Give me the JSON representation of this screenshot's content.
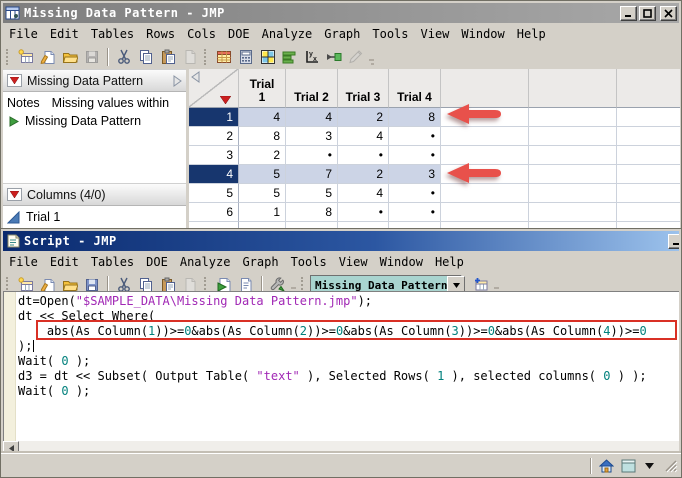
{
  "colors": {
    "accent_red": "#d93025",
    "arrow_red": "#e8514b",
    "selection_row": "#ccd4e6",
    "selection_header": "#17366e",
    "code_string": "#a128b5",
    "code_number": "#00807c",
    "combo_bg": "#a9d4cf",
    "titlebar_active": "#0a2a6e",
    "titlebar_inactive": "#8a8a8a"
  },
  "window1": {
    "title": "Missing Data Pattern - JMP",
    "title_buttons": [
      "minimize",
      "maximize",
      "close"
    ],
    "menu": [
      "File",
      "Edit",
      "Tables",
      "Rows",
      "Cols",
      "DOE",
      "Analyze",
      "Graph",
      "Tools",
      "View",
      "Window",
      "Help"
    ],
    "toolbar": [
      "grip",
      "new-table",
      "new-journal",
      "open",
      "!save",
      "sep",
      "cut",
      "copy",
      "paste",
      "!clear",
      "grip",
      "data-table",
      "calculator",
      "window-grid",
      "bar-chart",
      "fit-yx",
      "join",
      "!annotate",
      "ovf"
    ],
    "sidebar": {
      "table_panel_title": "Missing Data Pattern",
      "notes_label": "Notes",
      "notes_value": "Missing values within",
      "script_item": "Missing Data Pattern",
      "columns_panel_title": "Columns (4/0)",
      "column_items": [
        "Trial 1"
      ]
    },
    "grid": {
      "headers": [
        "Trial\n1",
        "Trial 2",
        "Trial 3",
        "Trial 4",
        "",
        "",
        ""
      ],
      "rows": [
        {
          "n": "1",
          "selected": true,
          "values": [
            "4",
            "4",
            "2",
            "8"
          ]
        },
        {
          "n": "2",
          "selected": false,
          "values": [
            "8",
            "3",
            "4",
            "•"
          ]
        },
        {
          "n": "3",
          "selected": false,
          "values": [
            "2",
            "•",
            "•",
            "•"
          ]
        },
        {
          "n": "4",
          "selected": true,
          "values": [
            "5",
            "7",
            "2",
            "3"
          ]
        },
        {
          "n": "5",
          "selected": false,
          "values": [
            "5",
            "5",
            "4",
            "•"
          ]
        },
        {
          "n": "6",
          "selected": false,
          "values": [
            "1",
            "8",
            "•",
            "•"
          ]
        }
      ]
    }
  },
  "window2": {
    "title": "Script - JMP",
    "title_buttons": [
      "minimize"
    ],
    "menu": [
      "File",
      "Edit",
      "Tables",
      "DOE",
      "Analyze",
      "Graph",
      "Tools",
      "View",
      "Window",
      "Help"
    ],
    "toolbar": [
      "grip",
      "new-table",
      "new-journal",
      "open",
      "save",
      "sep",
      "cut",
      "copy",
      "paste",
      "!clear",
      "grip",
      "run-script",
      "script-doc",
      "sep",
      "debug-tool",
      "ovf",
      "grip"
    ],
    "combo_value": "Missing Data Pattern",
    "statusbar_icons": [
      "home",
      "window-square",
      "menu-arrow",
      "resize-grip"
    ],
    "code": {
      "cursor_after_line": 4,
      "lines": [
        [
          [
            "p",
            "dt=Open("
          ],
          [
            "s",
            "\"$SAMPLE_DATA\\Missing Data Pattern.jmp\""
          ],
          [
            "p",
            ");"
          ]
        ],
        [
          [
            "p",
            "dt << Select Where("
          ]
        ],
        [
          [
            "p",
            "    abs(As Column("
          ],
          [
            "n",
            "1"
          ],
          [
            "p",
            "))>="
          ],
          [
            "n",
            "0"
          ],
          [
            "p",
            "&abs(As Column("
          ],
          [
            "n",
            "2"
          ],
          [
            "p",
            "))>="
          ],
          [
            "n",
            "0"
          ],
          [
            "p",
            "&abs(As Column("
          ],
          [
            "n",
            "3"
          ],
          [
            "p",
            "))>="
          ],
          [
            "n",
            "0"
          ],
          [
            "p",
            "&abs(As Column("
          ],
          [
            "n",
            "4"
          ],
          [
            "p",
            "))>="
          ],
          [
            "n",
            "0"
          ]
        ],
        [
          [
            "p",
            ");"
          ]
        ],
        [
          [
            "p",
            "Wait( "
          ],
          [
            "n",
            "0"
          ],
          [
            "p",
            " );"
          ]
        ],
        [
          [
            "p",
            "d3 = dt << Subset( Output Table( "
          ],
          [
            "s",
            "\"text\""
          ],
          [
            "p",
            " ), Selected Rows( "
          ],
          [
            "n",
            "1"
          ],
          [
            "p",
            " ), selected columns( "
          ],
          [
            "n",
            "0"
          ],
          [
            "p",
            " ) );"
          ]
        ],
        [
          [
            "p",
            "Wait( "
          ],
          [
            "n",
            "0"
          ],
          [
            "p",
            " );"
          ]
        ]
      ]
    }
  }
}
